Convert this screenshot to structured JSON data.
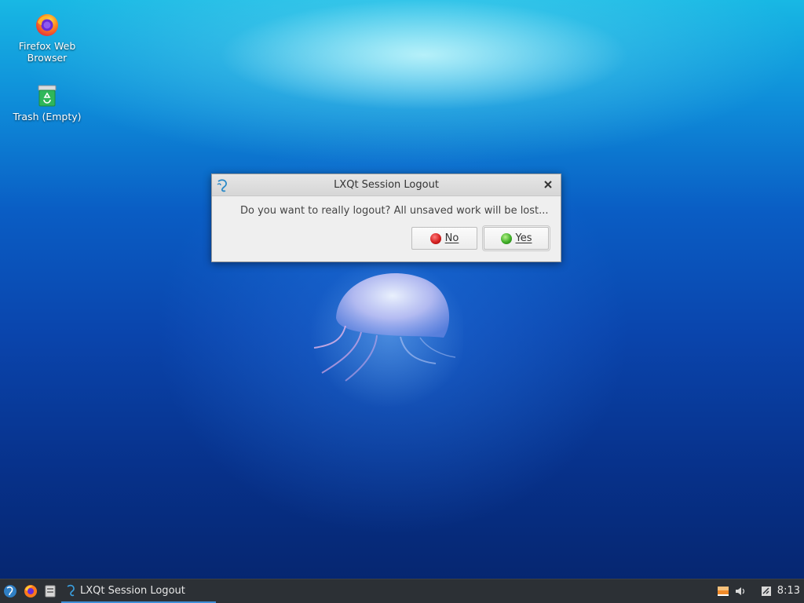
{
  "desktop": {
    "icons": [
      {
        "label_line1": "Firefox Web",
        "label_line2": "Browser",
        "icon": "firefox-icon"
      },
      {
        "label": "Trash (Empty)",
        "icon": "trash-icon"
      }
    ]
  },
  "dialog": {
    "title": "LXQt Session Logout",
    "message": "Do you want to really logout? All unsaved work will be lost...",
    "buttons": {
      "no": {
        "label": "No",
        "color": "#d42020"
      },
      "yes": {
        "label": "Yes",
        "color": "#3fae28"
      }
    }
  },
  "taskbar": {
    "launchers": [
      "lxqt-menu-icon",
      "firefox-icon",
      "file-manager-icon"
    ],
    "task": {
      "label": "LXQt Session Logout"
    },
    "tray": [
      "battery-icon",
      "volume-icon",
      "clipboard-icon"
    ],
    "clock": "8:13"
  },
  "colors": {
    "taskbar_bg": "#2c3035",
    "task_underline": "#3f8fd8",
    "dialog_bg": "#efefef"
  }
}
